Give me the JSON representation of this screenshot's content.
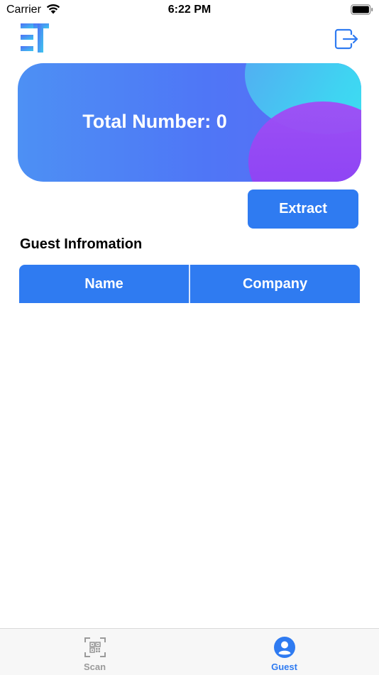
{
  "status_bar": {
    "carrier": "Carrier",
    "time": "6:22 PM",
    "wifi_icon": "wifi-icon",
    "battery_icon": "battery-icon"
  },
  "header": {
    "logo_icon": "et-logo",
    "logout_icon": "logout-icon"
  },
  "summary_card": {
    "total_label": "Total Number: 0"
  },
  "actions": {
    "extract_label": "Extract"
  },
  "guest_section": {
    "title": "Guest Infromation",
    "columns": [
      "Name",
      "Company"
    ],
    "rows": []
  },
  "tab_bar": {
    "tabs": [
      {
        "label": "Scan",
        "icon": "qr-scan-icon",
        "active": false
      },
      {
        "label": "Guest",
        "icon": "person-icon",
        "active": true
      }
    ]
  },
  "colors": {
    "accent": "#2f7bf1",
    "inactive_tab": "#9a9a9a"
  }
}
